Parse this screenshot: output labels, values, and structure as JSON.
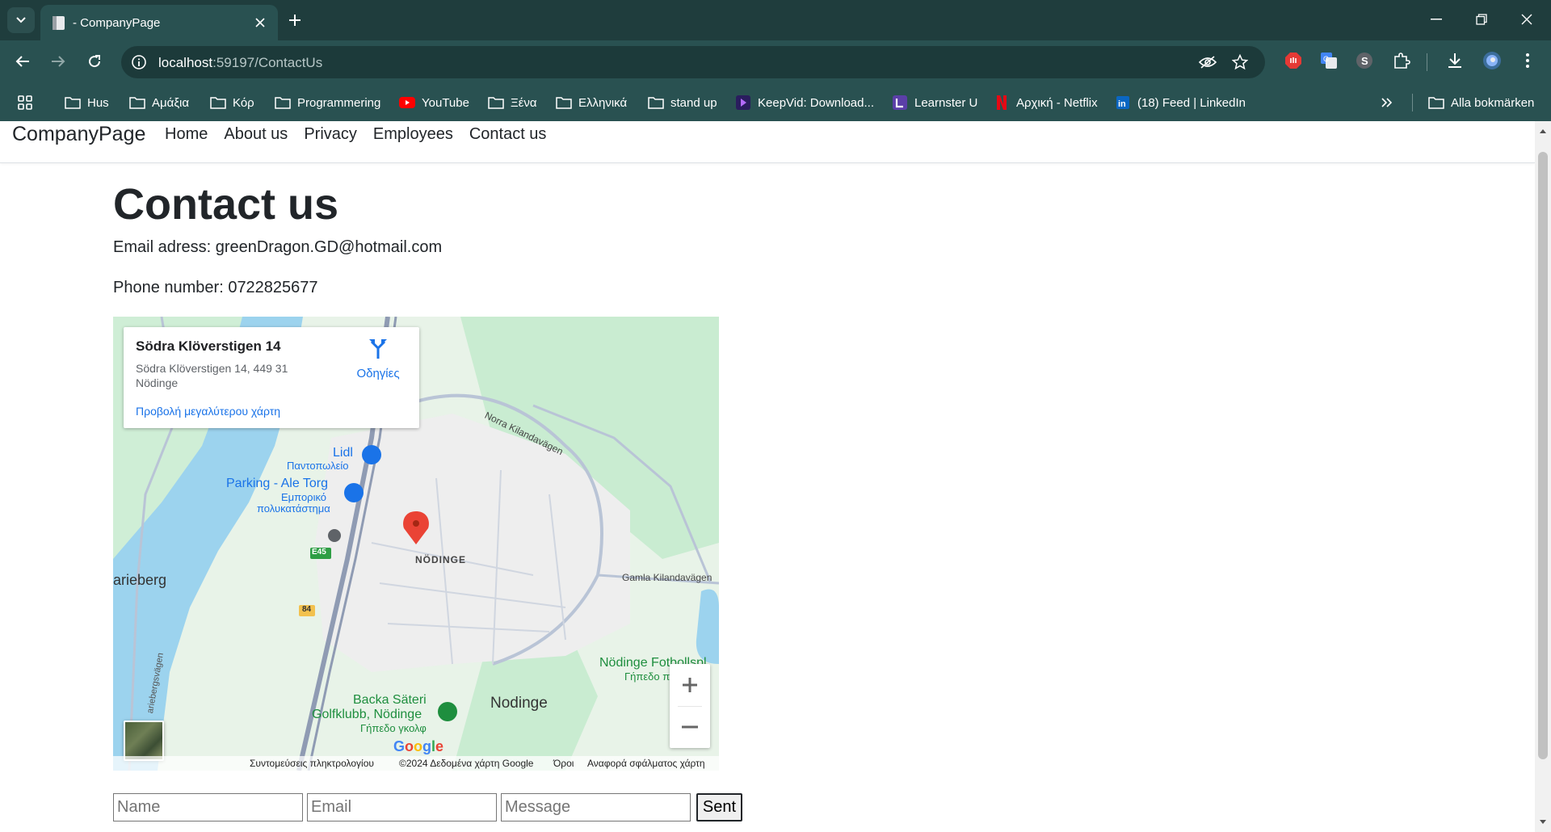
{
  "browser": {
    "tab_title": "- CompanyPage",
    "url_host": "localhost",
    "url_rest": ":59197/ContactUs",
    "bookmarks": [
      {
        "label": "Hus",
        "icon": "folder-icon"
      },
      {
        "label": "Αμάξια",
        "icon": "folder-icon"
      },
      {
        "label": "Κόρ",
        "icon": "folder-icon"
      },
      {
        "label": "Programmering",
        "icon": "folder-icon"
      },
      {
        "label": "YouTube",
        "icon": "youtube-icon"
      },
      {
        "label": "Ξένα",
        "icon": "folder-icon"
      },
      {
        "label": "Ελληνικά",
        "icon": "folder-icon"
      },
      {
        "label": "stand up",
        "icon": "folder-icon"
      },
      {
        "label": "KeepVid: Download...",
        "icon": "keepvid-icon"
      },
      {
        "label": "Learnster U",
        "icon": "learnster-icon"
      },
      {
        "label": "Αρχική - Netflix",
        "icon": "netflix-icon"
      },
      {
        "label": "(18) Feed | LinkedIn",
        "icon": "linkedin-icon"
      }
    ],
    "all_bookmarks": "Alla bokmärken"
  },
  "site": {
    "brand": "CompanyPage",
    "nav": [
      "Home",
      "About us",
      "Privacy",
      "Employees",
      "Contact us"
    ]
  },
  "page": {
    "title": "Contact us",
    "email_line": "Email adress: greenDragon.GD@hotmail.com",
    "phone_line": "Phone number: 0722825677"
  },
  "map": {
    "card_title": "Södra Klöverstigen 14",
    "card_address": "Södra Klöverstigen 14, 449 31 Nödinge",
    "directions_label": "Οδηγίες",
    "larger_map_link": "Προβολή μεγαλύτερου χάρτη",
    "labels": {
      "norra": "Norra Kilandavägen",
      "lidl": "Lidl",
      "lidl_sub": "Παντοπωλείο",
      "parking": "Parking - Ale Torg",
      "parking_sub1": "Εμπορικό",
      "parking_sub2": "πολυκατάστημα",
      "nodinge_caps": "NÖDINGE",
      "arieberg": "arieberg",
      "gamla": "Gamla Kilandavägen",
      "fotboll": "Nödinge Fotbollspl",
      "fotboll_sub": "Γήπεδο ποδ",
      "backa1": "Backa Säteri",
      "backa2": "Golfklubb, Nödinge",
      "backa_sub": "Γήπεδο γκολφ",
      "nodinge": "Nodinge",
      "e45": "E45",
      "r84": "84",
      "ariebergs": "ariebergsvägen"
    },
    "google": "Google",
    "attribution": [
      "Συντομεύσεις πληκτρολογίου",
      "©2024 Δεδομένα χάρτη Google",
      "Όροι",
      "Αναφορά σφάλματος χάρτη"
    ]
  },
  "form": {
    "name_placeholder": "Name",
    "email_placeholder": "Email",
    "message_placeholder": "Message",
    "submit_label": "Sent"
  }
}
